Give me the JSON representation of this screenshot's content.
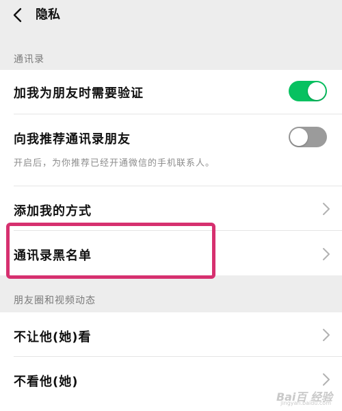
{
  "header": {
    "title": "隐私"
  },
  "sections": {
    "contacts": "通讯录",
    "moments": "朋友圈和视频动态"
  },
  "rows": {
    "verify_add": {
      "label": "加我为朋友时需要验证",
      "toggle_on": true
    },
    "recommend": {
      "label": "向我推荐通讯录朋友",
      "sub": "开启后，为你推荐已经开通微信的手机联系人。",
      "toggle_on": false
    },
    "add_methods": {
      "label": "添加我的方式"
    },
    "blacklist": {
      "label": "通讯录黑名单"
    },
    "hide_from": {
      "label": "不让他(她)看"
    },
    "dont_see": {
      "label": "不看他(她)"
    }
  },
  "colors": {
    "toggle_on": "#07c160",
    "toggle_off": "#9b9b9b",
    "highlight_box": "#d6306f"
  },
  "watermark": {
    "logo_text": "Bai百 经验",
    "url": "jingyan.baidu.com"
  }
}
